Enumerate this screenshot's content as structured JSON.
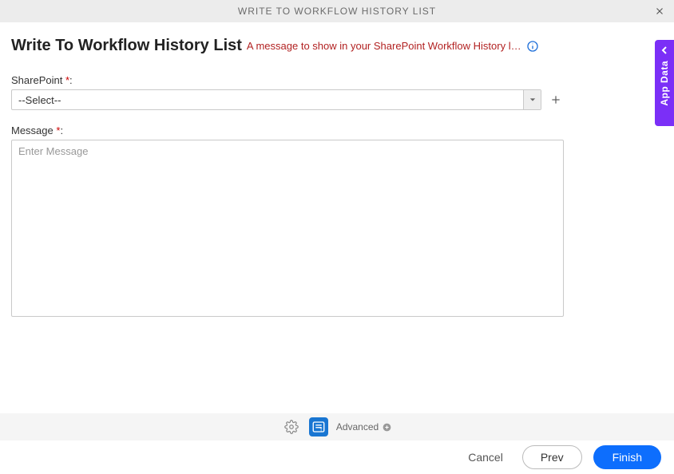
{
  "header": {
    "title": "WRITE TO WORKFLOW HISTORY LIST"
  },
  "page": {
    "title": "Write To Workflow History List",
    "description": "A message to show in your SharePoint Workflow History l…"
  },
  "fields": {
    "sharepoint": {
      "label": "SharePoint",
      "required_mark": "*",
      "colon": ":",
      "value": "--Select--"
    },
    "message": {
      "label": "Message",
      "required_mark": "*",
      "colon": ":",
      "placeholder": "Enter Message",
      "value": ""
    }
  },
  "toolbar": {
    "advanced_label": "Advanced"
  },
  "actions": {
    "cancel": "Cancel",
    "prev": "Prev",
    "finish": "Finish"
  },
  "sidetab": {
    "label": "App Data"
  }
}
